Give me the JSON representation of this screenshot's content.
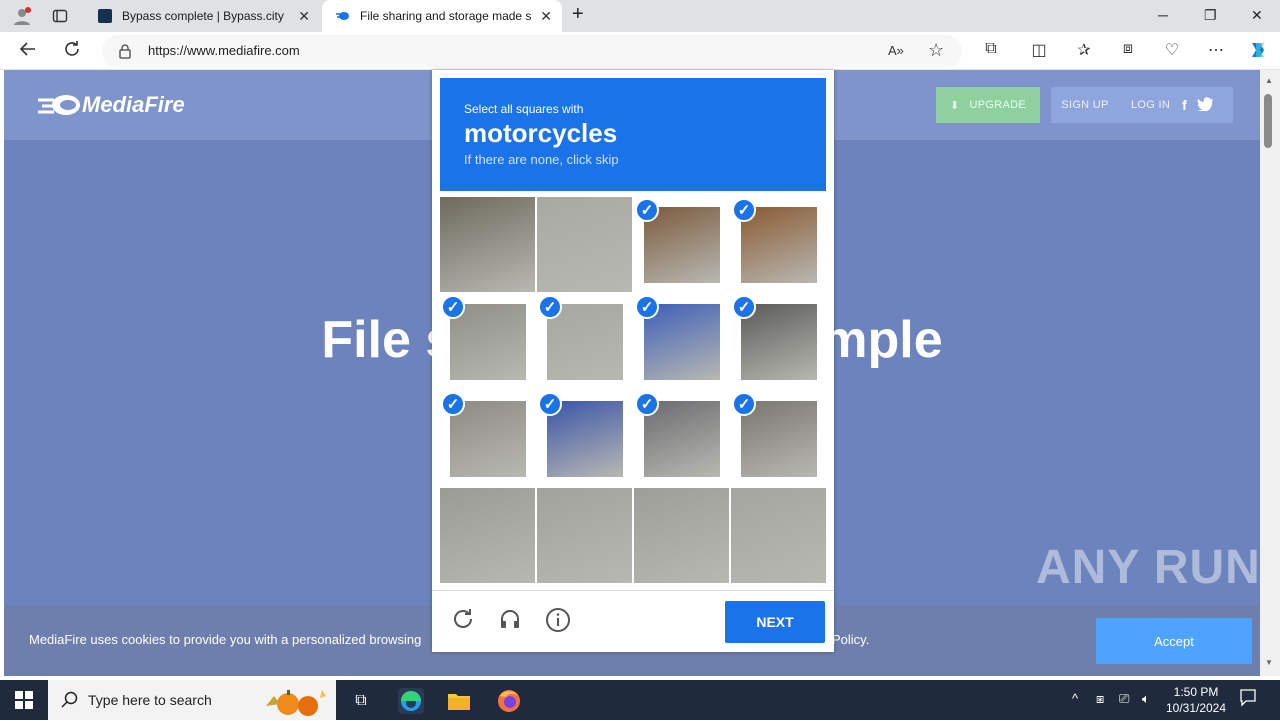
{
  "browser": {
    "tabs": [
      {
        "title": "Bypass complete | Bypass.city",
        "close": "✕"
      },
      {
        "title": "File sharing and storage made simple",
        "close": "✕"
      }
    ],
    "new_tab": "+",
    "url": "https://www.mediafire.com",
    "window_controls": {
      "minimize": "─",
      "restore": "❐",
      "close": "✕"
    }
  },
  "site": {
    "logo": "MediaFire",
    "nav": {
      "upgrade": "UPGRADE",
      "signup": "SIGN UP",
      "login": "LOG IN"
    },
    "hero": "File storage made simple",
    "cookie_text": "MediaFire uses cookies to provide you with a personalized browsing",
    "cookie_policy": "Policy.",
    "accept": "Accept"
  },
  "captcha": {
    "instruction": "Select all squares with",
    "target": "motorcycles",
    "hint": "If there are none, click skip",
    "next": "NEXT",
    "selected": [
      [
        false,
        false,
        true,
        true
      ],
      [
        true,
        true,
        true,
        true
      ],
      [
        true,
        true,
        true,
        true
      ],
      [
        false,
        false,
        false,
        false
      ]
    ]
  },
  "watermark": "ANY RUN",
  "taskbar": {
    "search_placeholder": "Type here to search",
    "time": "1:50 PM",
    "date": "10/31/2024"
  },
  "colors": {
    "accent": "#1a73e8",
    "site_bg": "#6c83bd",
    "taskbar": "#1f2a3c"
  }
}
